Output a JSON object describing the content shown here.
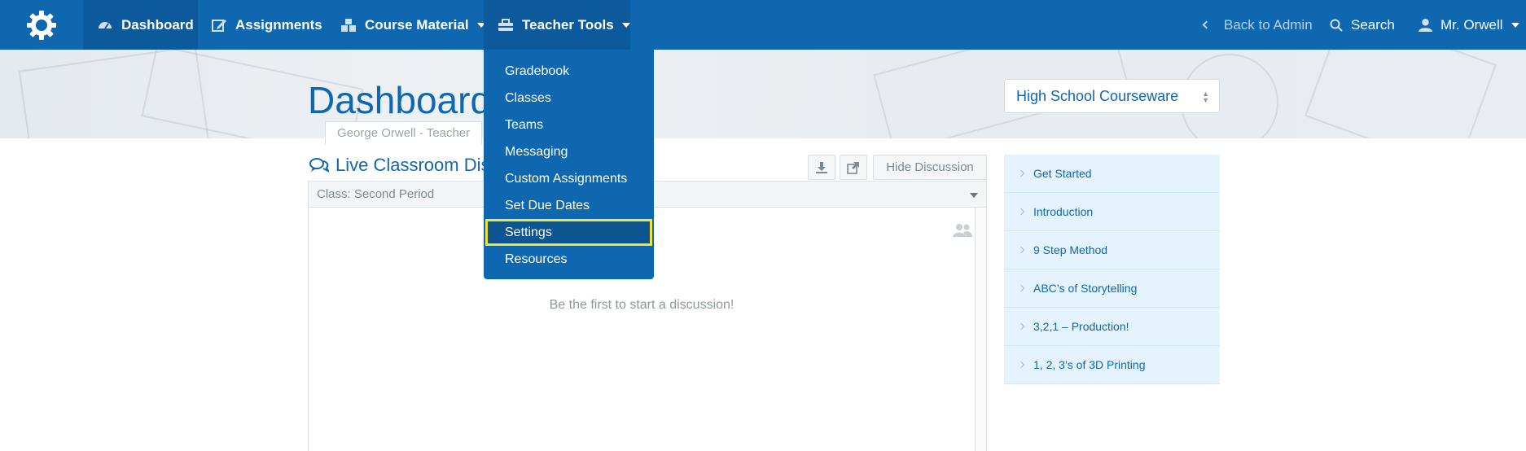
{
  "nav": {
    "dashboard": "Dashboard",
    "assignments": "Assignments",
    "course_material": "Course Material",
    "teacher_tools": "Teacher Tools",
    "back_to_admin": "Back to Admin",
    "search": "Search",
    "user": "Mr. Orwell"
  },
  "teacher_tools_menu": [
    "Gradebook",
    "Classes",
    "Teams",
    "Messaging",
    "Custom Assignments",
    "Set Due Dates",
    "Settings",
    "Resources"
  ],
  "hero": {
    "title": "Dashboard",
    "role_tab": "George Orwell - Teacher",
    "courseware_selected": "High School Courseware"
  },
  "discussion": {
    "title": "Live Classroom Dis",
    "hide_button": "Hide Discussion",
    "class_selector": "Class: Second Period",
    "empty_message": "Be the first to start a discussion!"
  },
  "side_list": [
    "Get Started",
    "Introduction",
    "9 Step Method",
    "ABC’s of Storytelling",
    "3,2,1 – Production!",
    "1, 2, 3’s of 3D Printing"
  ],
  "colors": {
    "nav_bg": "#0f67b0",
    "highlight_outline": "#f1e33b",
    "side_item_bg": "#e4f3fd"
  }
}
